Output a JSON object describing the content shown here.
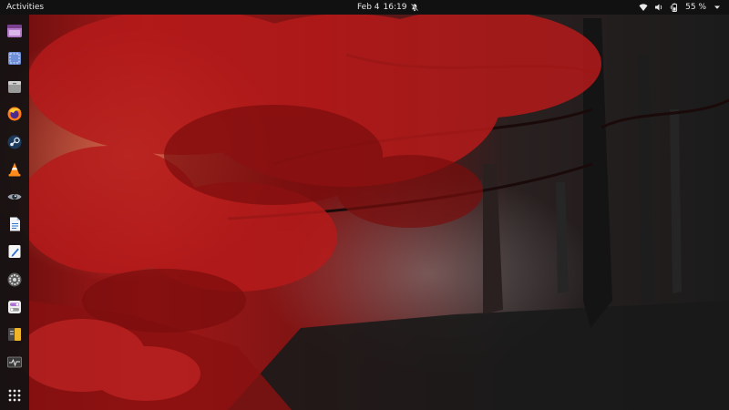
{
  "topbar": {
    "activities_label": "Activities",
    "date": "Feb 4",
    "time": "16:19",
    "battery_percent": "55 %"
  },
  "dock": {
    "items": [
      {
        "name": "screen-recorder",
        "icon": "screen-recorder-icon"
      },
      {
        "name": "screenshot-tool",
        "icon": "screenshot-icon"
      },
      {
        "name": "files",
        "icon": "folder-icon"
      },
      {
        "name": "firefox",
        "icon": "firefox-icon"
      },
      {
        "name": "steam",
        "icon": "steam-icon"
      },
      {
        "name": "vlc",
        "icon": "vlc-cone-icon"
      },
      {
        "name": "eye-of-gnome",
        "icon": "eye-icon"
      },
      {
        "name": "libreoffice-writer",
        "icon": "document-icon"
      },
      {
        "name": "text-editor",
        "icon": "pencil-note-icon"
      },
      {
        "name": "settings",
        "icon": "gear-icon"
      },
      {
        "name": "tweaks",
        "icon": "toggle-switches-icon"
      },
      {
        "name": "archive-manager",
        "icon": "archive-icon"
      },
      {
        "name": "system-monitor",
        "icon": "monitor-graph-icon"
      },
      {
        "name": "show-applications",
        "icon": "app-grid-icon"
      }
    ]
  },
  "colors": {
    "topbar_bg": "#111111",
    "dock_bg": "#121212",
    "wallpaper_red": "#b01c1c",
    "wallpaper_dark": "#1b1b1b"
  }
}
